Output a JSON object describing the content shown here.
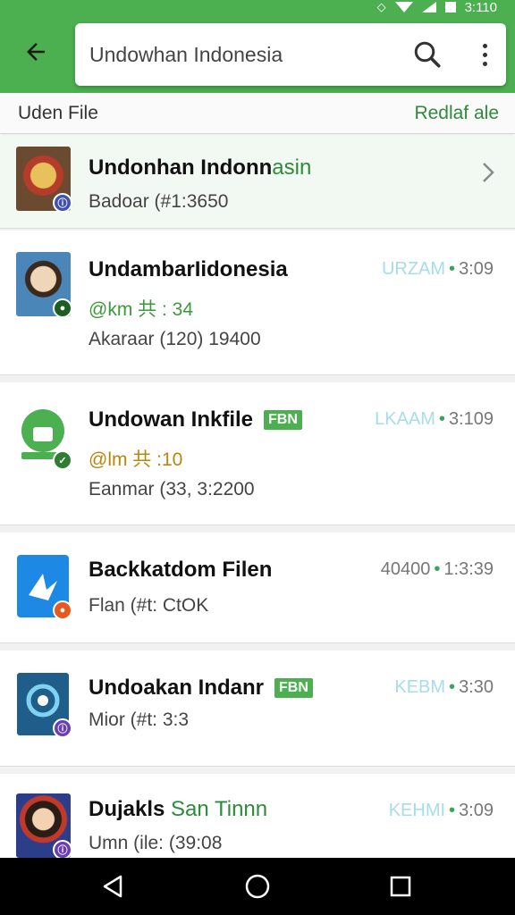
{
  "status_bar": {
    "time": "3:110"
  },
  "search": {
    "value": "Undowhan Indonesia"
  },
  "subheader": {
    "title": "Uden File",
    "action": "Redlaf ale"
  },
  "items": [
    {
      "title": "Undonhan Indonn",
      "title_green": "asin",
      "line1": "Badoar (#1:3650",
      "line2": "",
      "meta_tag": "",
      "meta_value": ""
    },
    {
      "title": "UndambarIidonesia",
      "title_green": "",
      "line1": "@km 共 : 34",
      "line2": "Akaraar (120) 19400",
      "meta_tag": "URZAM",
      "meta_value": "3:09"
    },
    {
      "title": "Undowan Inkfile",
      "title_green": "",
      "chip": "FBN",
      "line1": "@lm 共 :10",
      "line2": "Eanmar (33, 3:2200",
      "meta_tag": "LKAAM",
      "meta_value": "3:109"
    },
    {
      "title": "Backkatdom Filen",
      "title_green": "",
      "line1": "Flan (#t: CtOK",
      "line2": "",
      "meta_tag": "40400",
      "meta_value": "1:3:39"
    },
    {
      "title": "Undoakan Indanr",
      "title_green": "",
      "chip": "FBN",
      "line1": "Mior (#t: 3:3",
      "line2": "",
      "meta_tag": "KEBM",
      "meta_value": "3:30"
    },
    {
      "title": "Dujakls ",
      "title_green": "San Tinnn",
      "line1": "Umn (ile: (39:08",
      "line2": "",
      "meta_tag": "KEHMI",
      "meta_value": "3:09"
    }
  ],
  "colors": {
    "primary": "#4caf50",
    "accent_text": "#2e8b3a",
    "nav_bar": "#000000"
  },
  "icons": [
    "arrow-back-icon",
    "search-icon",
    "more-vert-icon",
    "chevron-right-icon",
    "back-nav-icon",
    "home-nav-icon",
    "recents-nav-icon"
  ]
}
